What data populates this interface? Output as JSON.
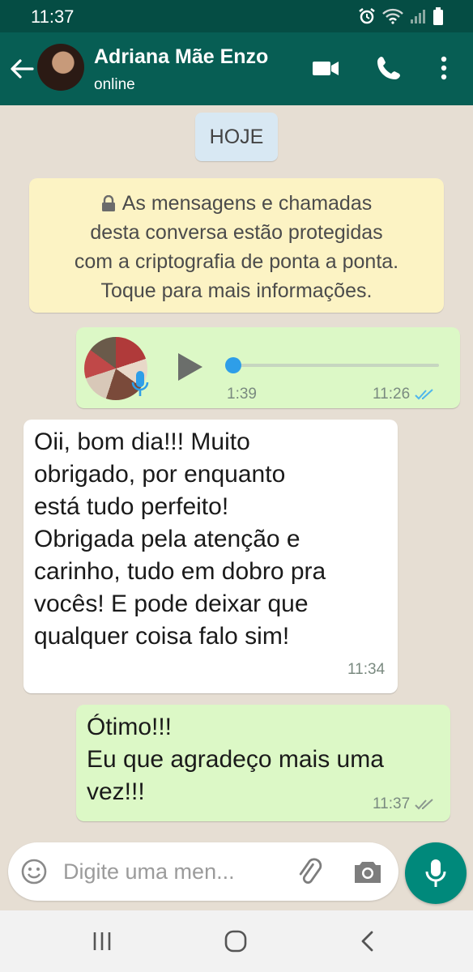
{
  "status_bar": {
    "time": "11:37"
  },
  "header": {
    "contact_name": "Adriana Mãe Enzo",
    "contact_status": "online"
  },
  "chat": {
    "date_chip": "HOJE",
    "e2e_notice": [
      "As mensagens e chamadas",
      "desta conversa estão protegidas",
      "com a criptografia de ponta a ponta.",
      "Toque para mais informações."
    ],
    "messages": [
      {
        "type": "voice",
        "direction": "outgoing",
        "duration": "1:39",
        "time": "11:26",
        "status": "read"
      },
      {
        "type": "text",
        "direction": "incoming",
        "text": "Oii, bom dia!!! Muito\nobrigado, por enquanto\nestá tudo perfeito!\nObrigada pela atenção e\ncarinho, tudo em dobro pra\nvocês! E pode deixar que\nqualquer coisa falo sim!",
        "time": "11:34"
      },
      {
        "type": "text",
        "direction": "outgoing",
        "text": "Ótimo!!!\nEu que agradeço mais uma\nvez!!!",
        "time": "11:37",
        "status": "delivered"
      }
    ]
  },
  "input_bar": {
    "placeholder": "Digite uma men..."
  },
  "colors": {
    "header": "#075e54",
    "status_bar": "#054d44",
    "outgoing_bubble": "#dcf8c6",
    "incoming_bubble": "#ffffff",
    "notice_bubble": "#fcf3c4",
    "read_ticks": "#4fb6ec",
    "mic_button": "#00897b"
  }
}
